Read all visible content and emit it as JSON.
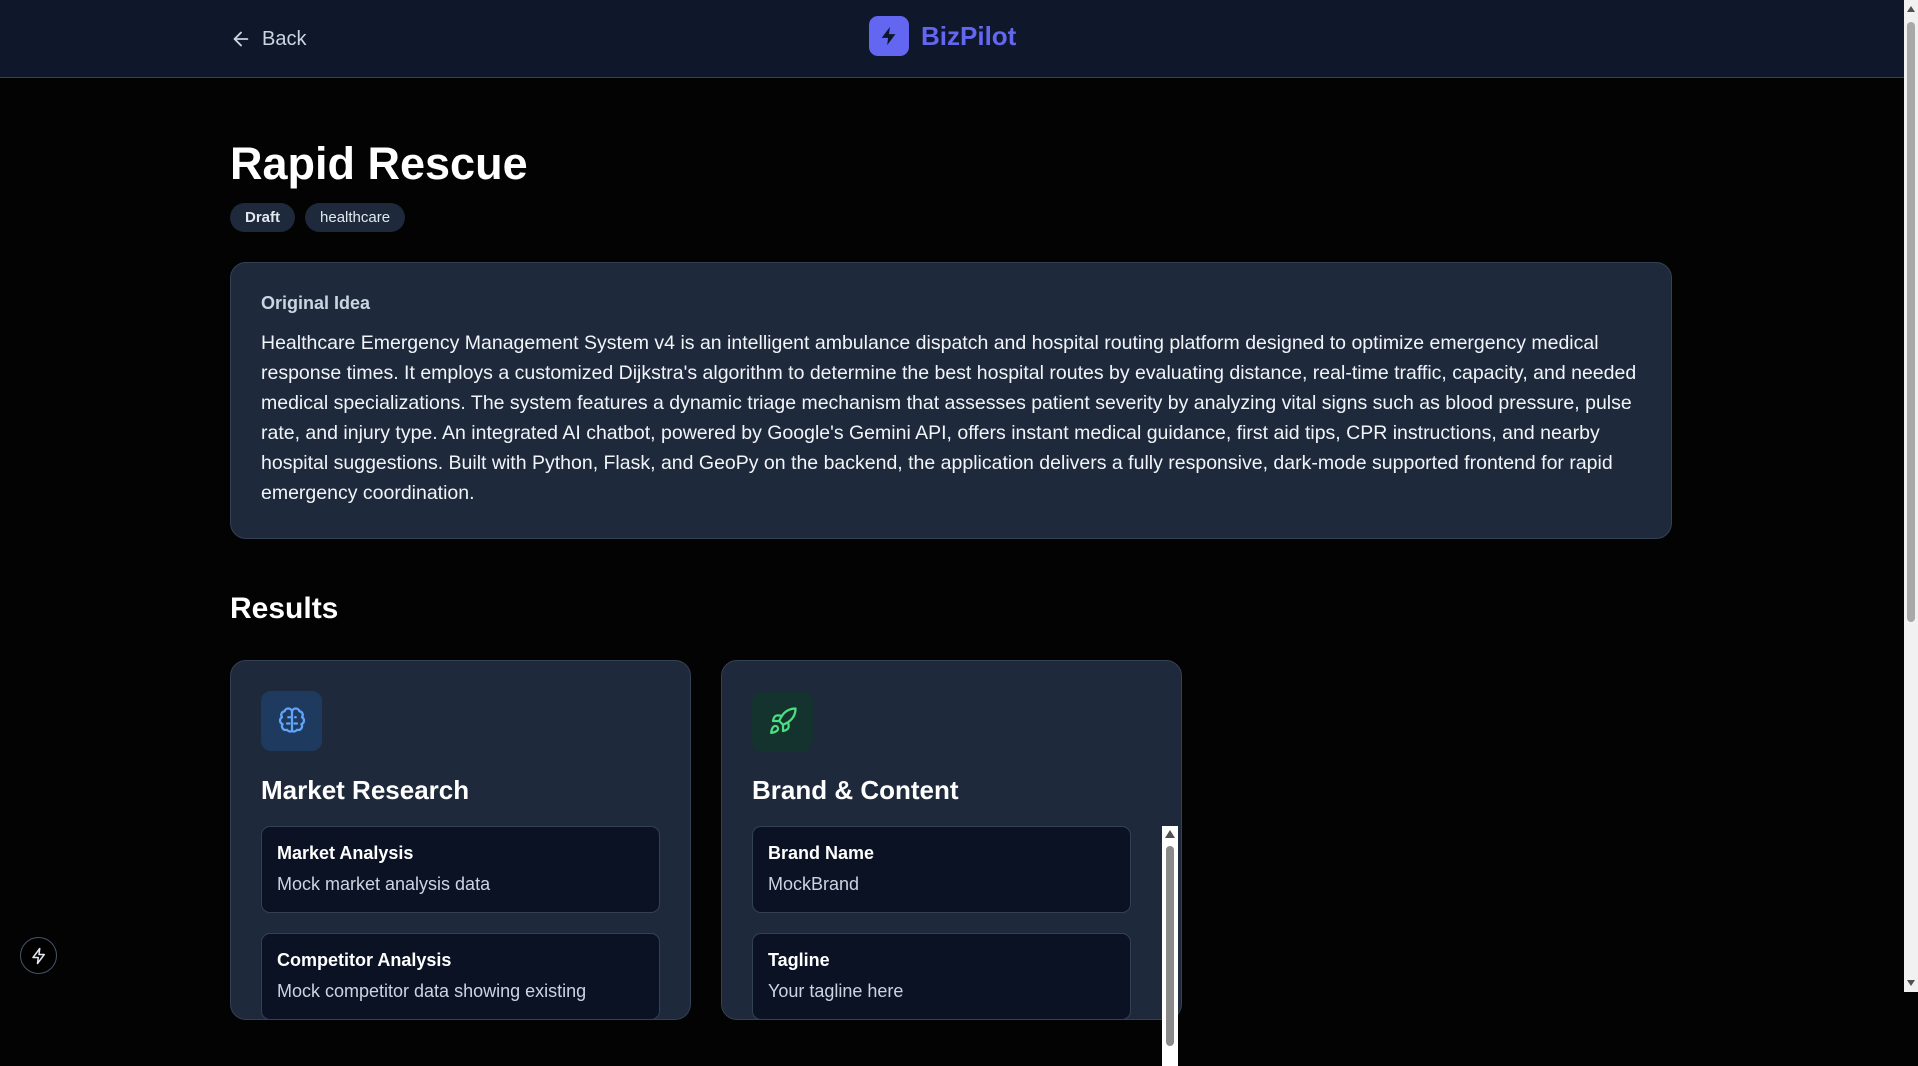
{
  "header": {
    "back_label": "Back",
    "brand_name": "BizPilot",
    "brand_color": "#6366f1"
  },
  "project": {
    "title": "Rapid Rescue",
    "status": "Draft",
    "category": "healthcare"
  },
  "idea": {
    "label": "Original Idea",
    "text": "Healthcare Emergency Management System v4 is an intelligent ambulance dispatch and hospital routing platform designed to optimize emergency medical response times. It employs a customized Dijkstra's algorithm to determine the best hospital routes by evaluating distance, real-time traffic, capacity, and needed medical specializations. The system features a dynamic triage mechanism that assesses patient severity by analyzing vital signs such as blood pressure, pulse rate, and injury type. An integrated AI chatbot, powered by Google's Gemini API, offers instant medical guidance, first aid tips, CPR instructions, and nearby hospital suggestions. Built with Python, Flask, and GeoPy on the backend, the application delivers a fully responsive, dark-mode supported frontend for rapid emergency coordination."
  },
  "results": {
    "heading": "Results",
    "cards": [
      {
        "title": "Market Research",
        "icon": "brain-icon",
        "items": [
          {
            "title": "Market Analysis",
            "value": "Mock market analysis data"
          },
          {
            "title": "Competitor Analysis",
            "value": "Mock competitor data showing existing"
          }
        ]
      },
      {
        "title": "Brand & Content",
        "icon": "rocket-icon",
        "items": [
          {
            "title": "Brand Name",
            "value": "MockBrand"
          },
          {
            "title": "Tagline",
            "value": "Your tagline here"
          }
        ]
      }
    ]
  }
}
